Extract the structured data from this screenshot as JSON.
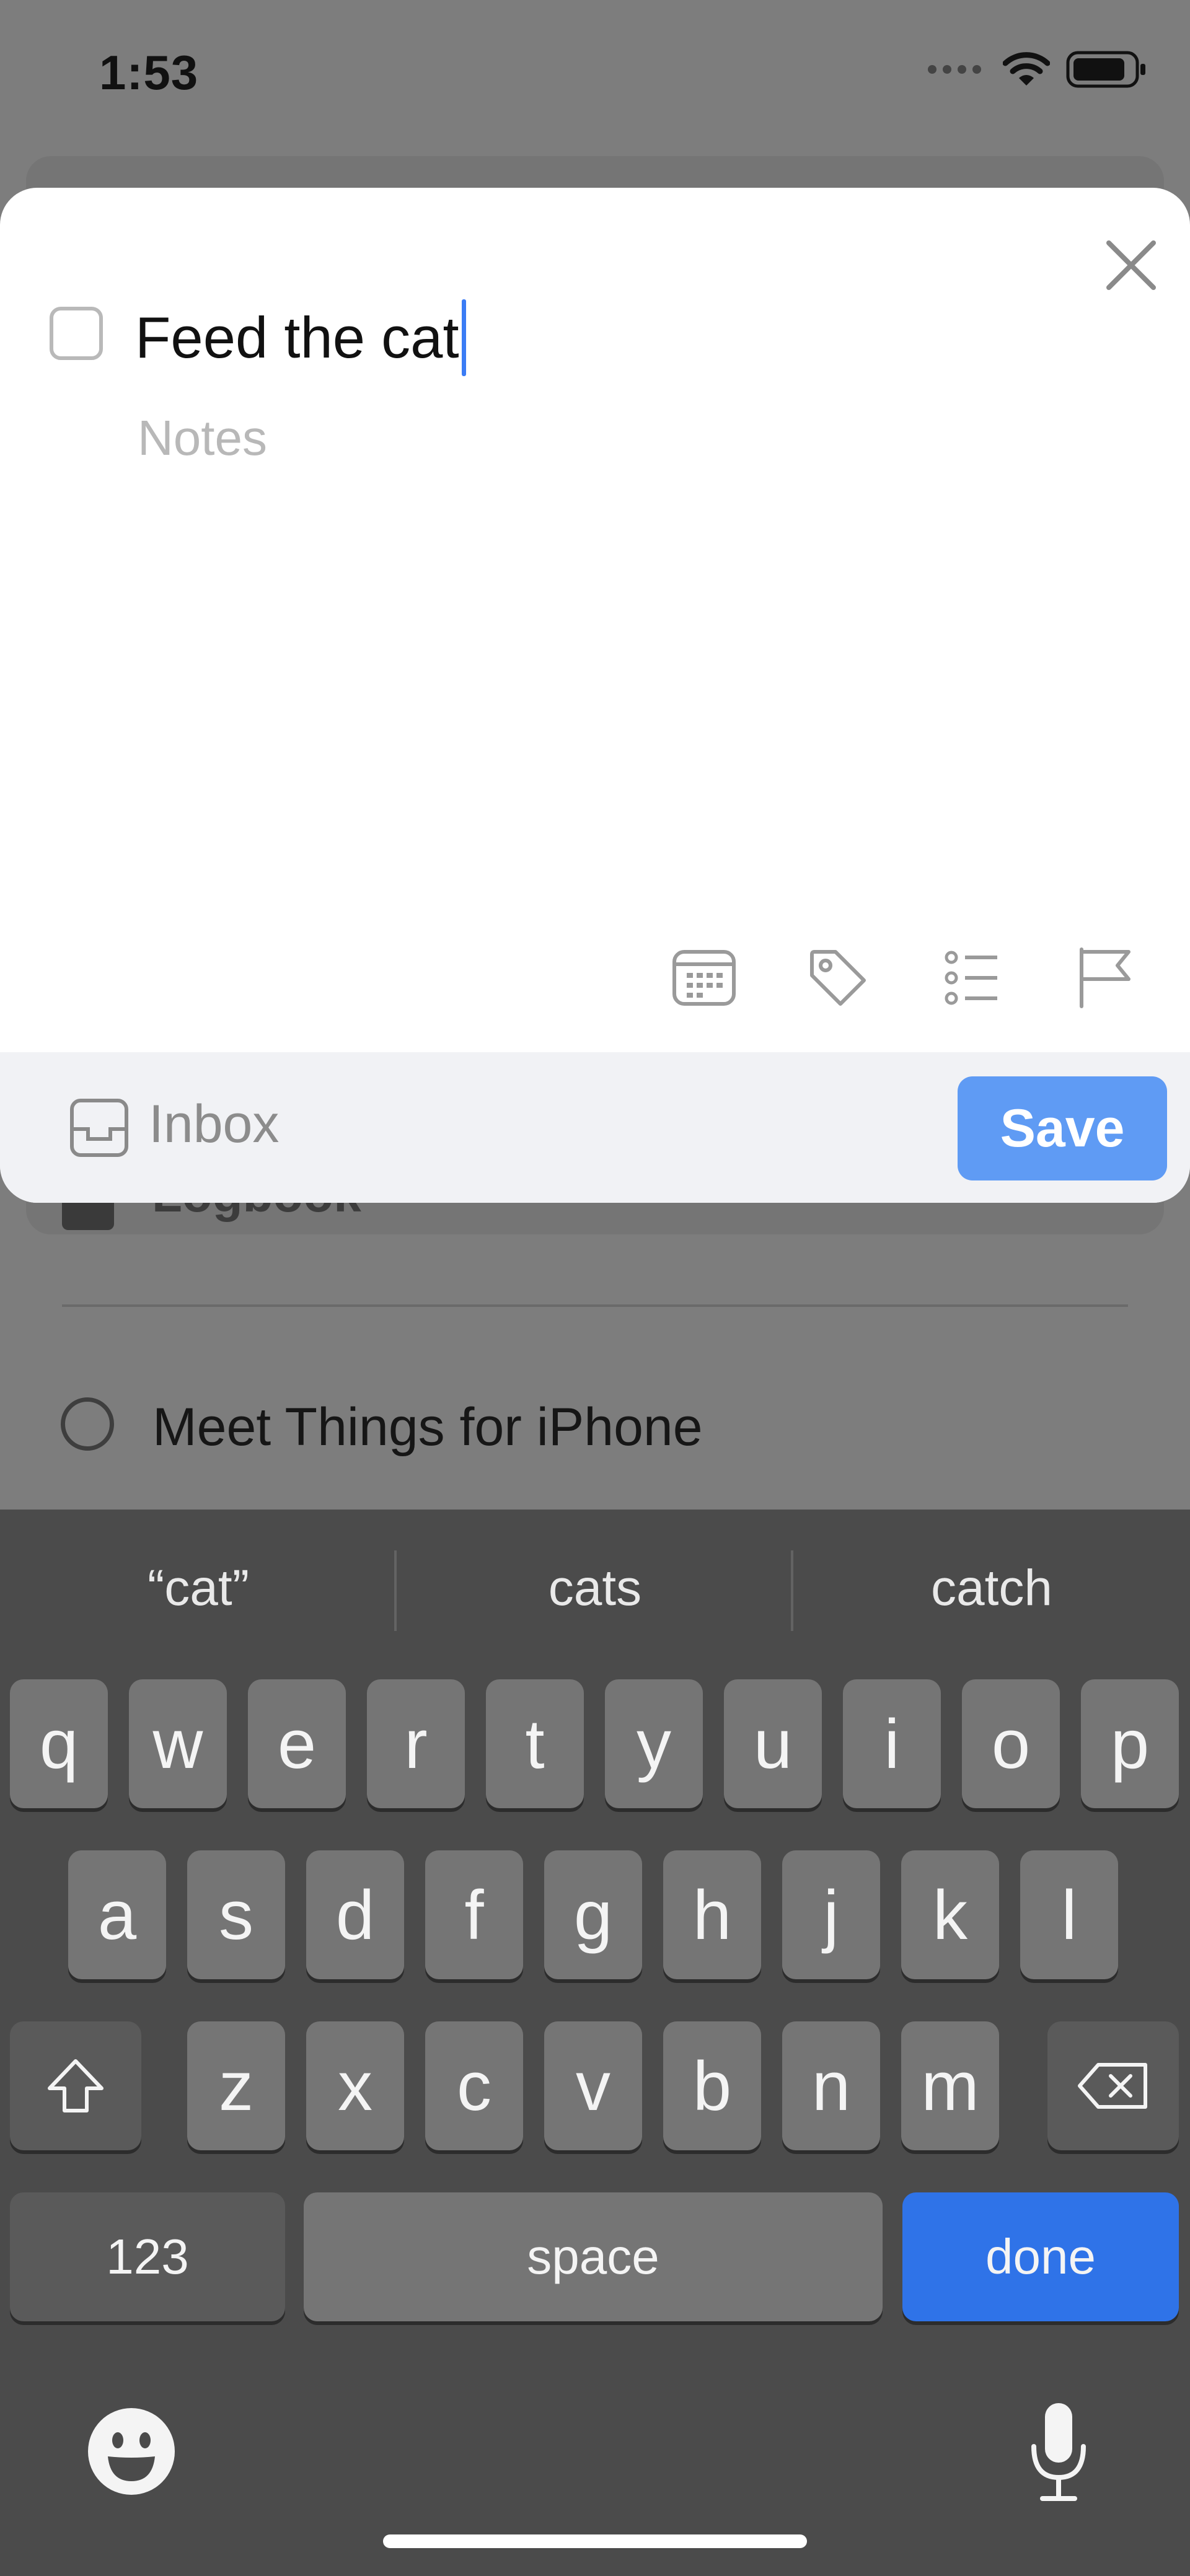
{
  "status_bar": {
    "time": "1:53"
  },
  "background": {
    "logbook_label": "Logbook",
    "todo_label": "Meet Things for iPhone"
  },
  "sheet": {
    "title_value": "Feed the cat",
    "notes_placeholder": "Notes",
    "list_label": "Inbox",
    "save_label": "Save",
    "toolbar_icons": [
      "calendar-icon",
      "tag-icon",
      "checklist-icon",
      "flag-icon"
    ]
  },
  "keyboard": {
    "suggestions": [
      "“cat”",
      "cats",
      "catch"
    ],
    "row1": [
      "q",
      "w",
      "e",
      "r",
      "t",
      "y",
      "u",
      "i",
      "o",
      "p"
    ],
    "row2": [
      "a",
      "s",
      "d",
      "f",
      "g",
      "h",
      "j",
      "k",
      "l"
    ],
    "row3": [
      "z",
      "x",
      "c",
      "v",
      "b",
      "n",
      "m"
    ],
    "numbers_label": "123",
    "space_label": "space",
    "done_label": "done"
  },
  "colors": {
    "accent": "#5f9bf4",
    "done_key": "#2f73e8",
    "caret": "#3b7cf5"
  }
}
